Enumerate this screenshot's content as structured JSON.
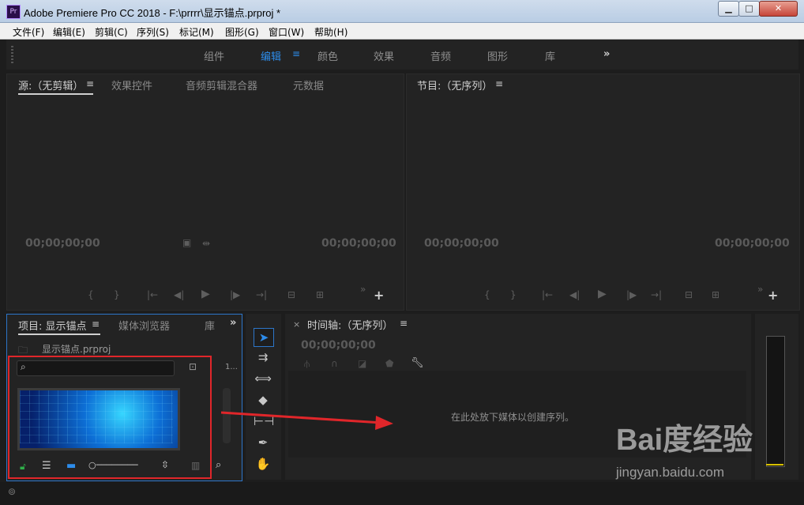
{
  "window": {
    "title": "Adobe Premiere Pro CC 2018 - F:\\prrrr\\显示锚点.prproj *",
    "app_icon": "Pr"
  },
  "menu": [
    "文件(F)",
    "编辑(E)",
    "剪辑(C)",
    "序列(S)",
    "标记(M)",
    "图形(G)",
    "窗口(W)",
    "帮助(H)"
  ],
  "workspaces": {
    "tabs": [
      "组件",
      "编辑",
      "颜色",
      "效果",
      "音频",
      "图形",
      "库"
    ],
    "active_index": 1,
    "more": "»"
  },
  "source_panel": {
    "tabs": [
      "源:（无剪辑）",
      "效果控件",
      "音频剪辑混合器",
      "元数据"
    ],
    "menu_glyph": "≡",
    "timecode_left": "00;00;00;00",
    "timecode_right": "00;00;00;00",
    "add_glyph": "+",
    "more_glyph": "»"
  },
  "program_panel": {
    "tab": "节目:（无序列）",
    "menu_glyph": "≡",
    "timecode_left": "00;00;00;00",
    "timecode_right": "00;00;00;00",
    "add_glyph": "+",
    "more_glyph": "»"
  },
  "project_panel": {
    "tabs": [
      "项目: 显示锚点",
      "媒体浏览器",
      "庫"
    ],
    "menu_glyph": "≡",
    "more": "»",
    "file_name": "显示锚点.prproj",
    "item_count": "1..."
  },
  "timeline": {
    "title": "时间轴:（无序列）",
    "close": "×",
    "menu_glyph": "≡",
    "timecode": "00;00;00;00",
    "drop_message": "在此处放下媒体以创建序列。"
  },
  "watermark": {
    "logo": "Bai度经验",
    "url": "jingyan.baidu.com"
  },
  "colors": {
    "accent": "#2d8ceb",
    "annotation": "#e0262a",
    "panel": "#232323"
  }
}
